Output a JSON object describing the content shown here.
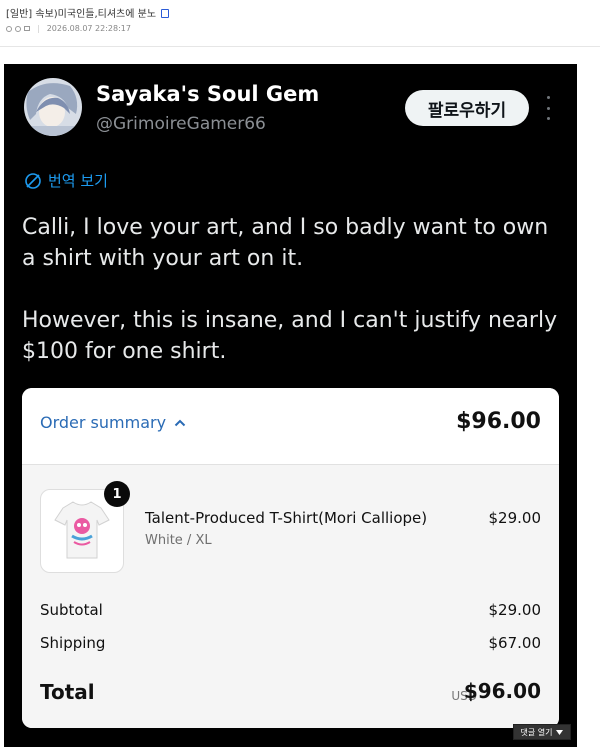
{
  "post": {
    "title": "[일반] 속보)미국인들,티셔츠에 분노",
    "timestamp": "2026.08.07 22:28:17"
  },
  "tweet": {
    "display_name": "Sayaka's Soul Gem",
    "handle": "@GrimoireGamer66",
    "follow_label": "팔로우하기",
    "translate_label": "번역 보기",
    "paragraphs": [
      "Calli, I love your art, and I so badly want to own a shirt with your art on it.",
      "However, this is insane, and I can't justify nearly $100 for one shirt."
    ]
  },
  "order": {
    "summary_label": "Order summary",
    "summary_total": "$96.00",
    "item": {
      "quantity": "1",
      "name": "Talent-Produced T-Shirt(Mori Calliope)",
      "variant": "White / XL",
      "price": "$29.00"
    },
    "subtotal_label": "Subtotal",
    "subtotal_value": "$29.00",
    "shipping_label": "Shipping",
    "shipping_value": "$67.00",
    "total_label": "Total",
    "total_currency": "USD",
    "total_value": "$96.00"
  },
  "comments_button_label": "댓글 열기",
  "colors": {
    "tweet_bg": "#000000",
    "link_blue": "#1d9bf0",
    "order_link": "#2a6bb5"
  }
}
